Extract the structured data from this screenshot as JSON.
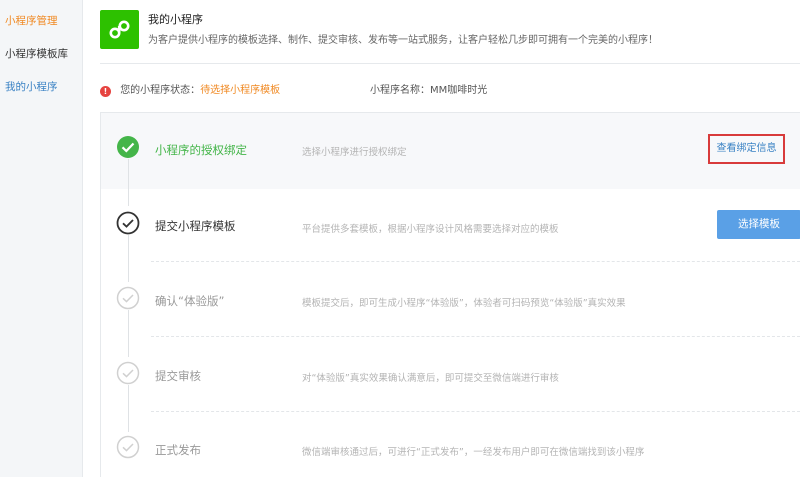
{
  "sidebar": {
    "items": [
      {
        "label": "小程序管理",
        "color": "#f08a24"
      },
      {
        "label": "小程序模板库",
        "color": "#333333"
      },
      {
        "label": "我的小程序",
        "color": "#3a82c4"
      }
    ]
  },
  "header": {
    "title": "我的小程序",
    "description": "为客户提供小程序的模板选择、制作、提交审核、发布等一站式服务，让客户轻松几步即可拥有一个完美的小程序！",
    "logo_icon": "miniprogram-logo-icon",
    "logo_color": "#2dc100"
  },
  "status": {
    "label": "您的小程序状态：",
    "value": "待选择小程序模板",
    "name_label": "小程序名称：",
    "name_value": "MM咖啡时光",
    "icon": "warning-icon"
  },
  "steps": [
    {
      "title": "小程序的授权绑定",
      "desc": "选择小程序进行授权绑定",
      "state": "done",
      "action": "查看绑定信息"
    },
    {
      "title": "提交小程序模板",
      "desc": "平台提供多套模板，根据小程序设计风格需要选择对应的模板",
      "state": "current",
      "action": "选择模板"
    },
    {
      "title": "确认“体验版”",
      "desc": "模板提交后，即可生成小程序“体验版”，体验者可扫码预览“体验版”真实效果",
      "state": "pending"
    },
    {
      "title": "提交审核",
      "desc": "对“体验版”真实效果确认满意后，即可提交至微信端进行审核",
      "state": "pending"
    },
    {
      "title": "正式发布",
      "desc": "微信端审核通过后，可进行“正式发布”，一经发布用户即可在微信端找到该小程序",
      "state": "pending"
    }
  ],
  "colors": {
    "done": "#44b549",
    "current": "#333333",
    "pending": "#cccccc",
    "primary_button": "#5aa0e6",
    "link": "#3a82c4",
    "highlight_border": "#d83b3b"
  }
}
